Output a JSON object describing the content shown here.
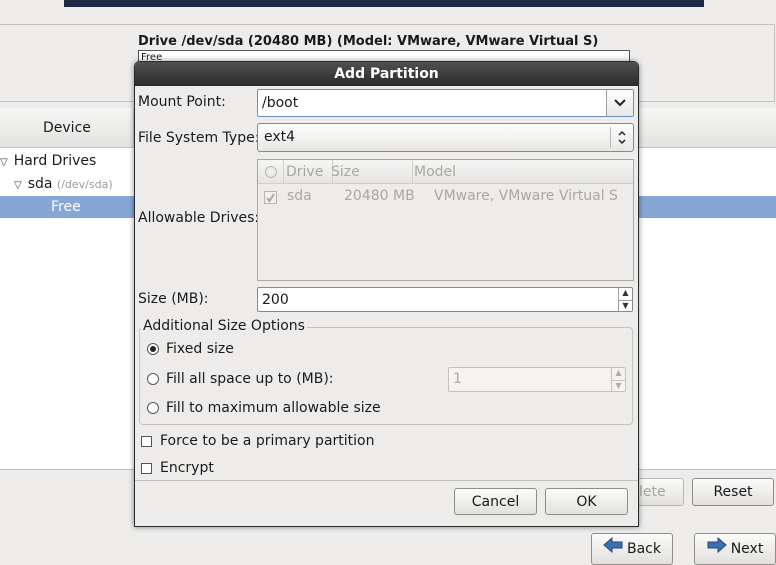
{
  "background": {
    "drive_title": "Drive /dev/sda (20480 MB) (Model: VMware, VMware Virtual S)",
    "drive_bar_label": "Free",
    "tree_header": "Device",
    "tree": [
      {
        "label": "Hard Drives",
        "sub": ""
      },
      {
        "label": "sda",
        "sub": "(/dev/sda)"
      },
      {
        "label": "Free",
        "sub": ""
      }
    ],
    "buttons": {
      "delete": "lete",
      "reset": "Reset",
      "back": "Back",
      "next": "Next"
    }
  },
  "dialog": {
    "title": "Add Partition",
    "mount_point_label": "Mount Point:",
    "mount_point_value": "/boot",
    "fs_type_label": "File System Type:",
    "fs_type_value": "ext4",
    "allowable_drives_label": "Allowable Drives:",
    "drives_columns": [
      "Drive",
      "Size",
      "Model"
    ],
    "drives_rows": [
      {
        "drive": "sda",
        "size": "20480 MB",
        "model": "VMware, VMware Virtual S",
        "checked": true
      }
    ],
    "size_label": "Size (MB):",
    "size_value": "200",
    "size_options_legend": "Additional Size Options",
    "opt_fixed": "Fixed size",
    "opt_fill_upto": "Fill all space up to (MB):",
    "opt_fill_upto_value": "1",
    "opt_fill_max": "Fill to maximum allowable size",
    "selected_size_option": "fixed",
    "force_primary": "Force to be a primary partition",
    "encrypt": "Encrypt",
    "cancel": "Cancel",
    "ok": "OK"
  },
  "colors": {
    "selection": "#86a7d5",
    "title_bar": "#2a2a2a"
  }
}
